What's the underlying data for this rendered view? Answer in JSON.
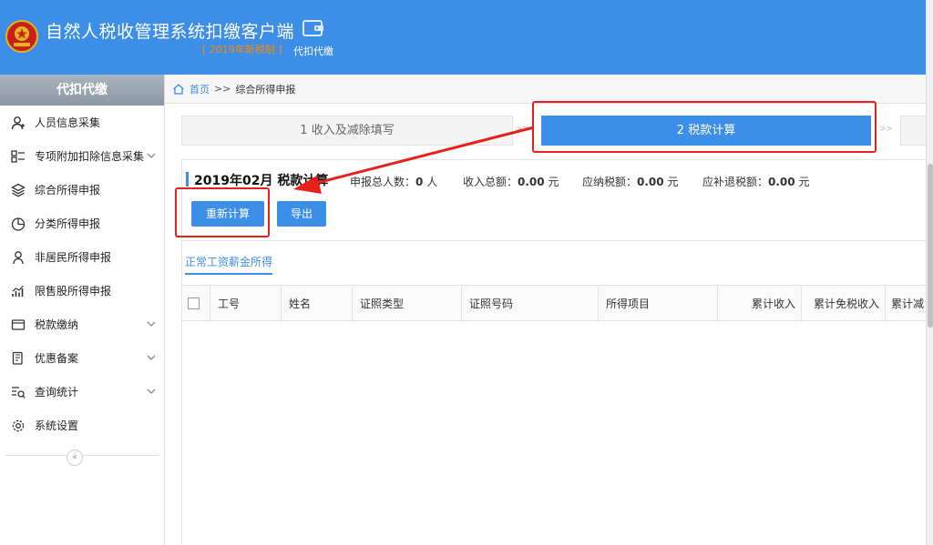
{
  "app": {
    "title": "自然人税收管理系统扣缴客户端",
    "version": "[ 2019年新税制 ]",
    "nav_tab": "代扣代缴"
  },
  "sidebar": {
    "title": "代扣代缴",
    "items": [
      {
        "label": "人员信息采集",
        "icon": "user-icon",
        "has_chevron": false
      },
      {
        "label": "专项附加扣除信息采集",
        "icon": "list-icon",
        "has_chevron": true
      },
      {
        "label": "综合所得申报",
        "icon": "layers-icon",
        "has_chevron": false
      },
      {
        "label": "分类所得申报",
        "icon": "pie-chart-icon",
        "has_chevron": false
      },
      {
        "label": "非居民所得申报",
        "icon": "person-icon",
        "has_chevron": false
      },
      {
        "label": "限售股所得申报",
        "icon": "bar-chart-icon",
        "has_chevron": false
      },
      {
        "label": "税款缴纳",
        "icon": "wallet-icon",
        "has_chevron": true
      },
      {
        "label": "优惠备案",
        "icon": "document-icon",
        "has_chevron": true
      },
      {
        "label": "查询统计",
        "icon": "search-list-icon",
        "has_chevron": true
      },
      {
        "label": "系统设置",
        "icon": "gear-icon",
        "has_chevron": false
      }
    ],
    "collapse": "«"
  },
  "breadcrumb": {
    "home": "首页",
    "sep": ">>",
    "current": "综合所得申报"
  },
  "steps": {
    "step1": "1 收入及减除填写",
    "step2": "2 税款计算",
    "arrow": ">>"
  },
  "period": {
    "title": "2019年02月  税款计算",
    "count_label": "申报总人数：",
    "count_value": "0",
    "count_unit": " 人",
    "income_label": "收入总额：",
    "income_value": "0.00",
    "income_unit": " 元",
    "tax_label": "应纳税额：",
    "tax_value": "0.00",
    "tax_unit": " 元",
    "refund_label": "应补退税额：",
    "refund_value": "0.00",
    "refund_unit": " 元"
  },
  "buttons": {
    "recalc": "重新计算",
    "export": "导出"
  },
  "subtab": "正常工资薪金所得",
  "table": {
    "columns": [
      "工号",
      "姓名",
      "证照类型",
      "证照号码",
      "所得项目",
      "累计收入",
      "累计免税收入",
      "累计减"
    ]
  },
  "colors": {
    "header": "#3d8ee6",
    "accent": "#3d8ee6",
    "version": "#ff8a00",
    "annotation": "#e8201a"
  }
}
